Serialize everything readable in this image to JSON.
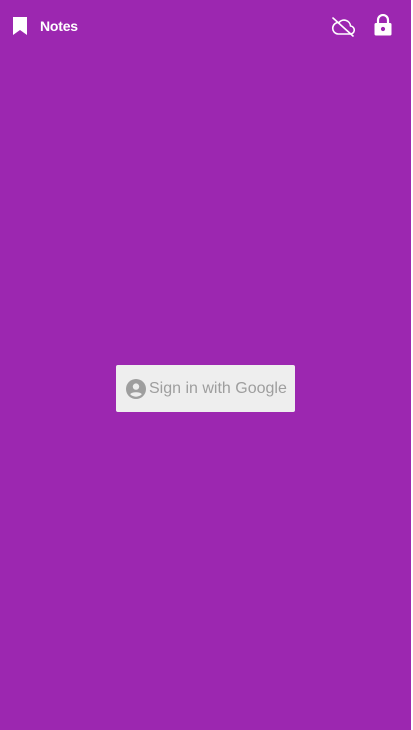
{
  "app": {
    "title": "Notes"
  },
  "colors": {
    "background": "#9c27b0",
    "foreground": "#ffffff",
    "button_background": "#eeeeee",
    "button_text": "#9e9e9e"
  },
  "icons": {
    "title": "bookmark-icon",
    "sync": "cloud-off-icon",
    "lock": "lock-icon",
    "account": "account-circle-icon"
  },
  "signin": {
    "label": "Sign in with Google"
  }
}
